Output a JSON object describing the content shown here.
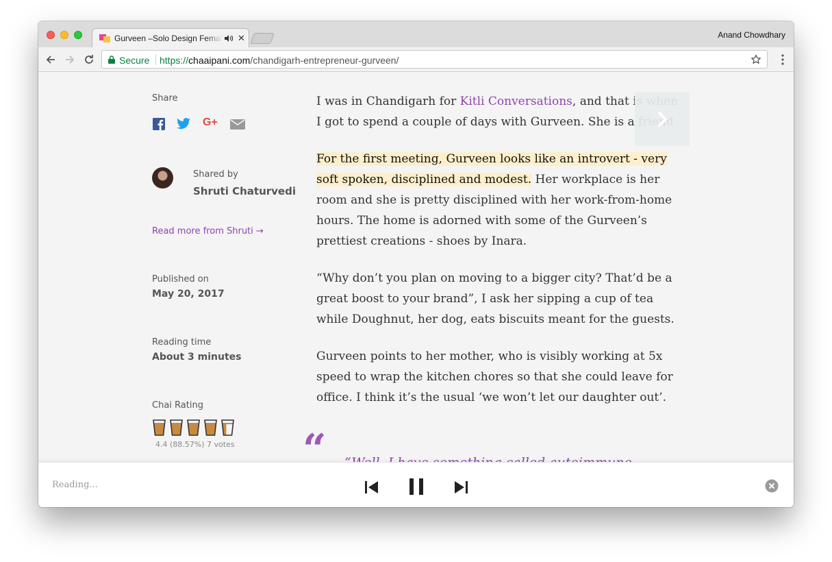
{
  "browser": {
    "tab_title": "Gurveen –Solo Design Female Entrepreneur",
    "tab_close": "✕",
    "profile_name": "Anand Chowdhary",
    "secure_label": "Secure",
    "url_scheme": "https://",
    "url_host": "chaaipani.com",
    "url_path": "/chandigarh-entrepreneur-gurveen/"
  },
  "sidebar": {
    "share_label": "Share",
    "share_icons": [
      "facebook-icon",
      "twitter-icon",
      "google-plus-icon",
      "email-icon"
    ],
    "google_plus_text": "G+",
    "shared_by_label": "Shared by",
    "author_name": "Shruti Chaturvedi",
    "read_more": "Read more from Shruti  →",
    "published_label": "Published on",
    "published_date": "May 20, 2017",
    "reading_time_label": "Reading time",
    "reading_time": "About 3 minutes",
    "chai_rating_label": "Chai Rating",
    "rating_value": 4.4,
    "rating_max": 5,
    "rating_text": "4.4 (88.57%) 7 votes"
  },
  "article": {
    "p1_before": "I was in Chandigarh for ",
    "p1_link": "Kitli Conversations",
    "p1_after": ", and that is when I got to spend a couple of days with Gurveen. She is a friend",
    "p2_highlight": "For the first meeting, Gurveen looks like an introvert - very soft spoken, disciplined and modest.",
    "p2_rest": " Her workplace is her room and she is pretty disciplined with her work-from-home hours. The home is adorned with some of the Gurveen’s prettiest creations - shoes by Inara.",
    "p3": "“Why don’t you plan on moving to a bigger city? That’d be a great boost to your brand”, I ask her sipping a cup of tea while Doughnut, her dog, eats biscuits meant for the guests.",
    "p4": "Gurveen points to her mother, who is visibly working at 5x speed to wrap the kitchen chores so that she could leave for office. I think it’s the usual ‘we won’t let our daughter out’.",
    "quote_mark": "“",
    "pullquote": "“Well, I have something called autoimmune disease. Basically, my immune system cannot differentiate"
  },
  "player": {
    "status": "Reading..."
  },
  "colors": {
    "accent": "#8e44ad",
    "highlight": "#fdefcc",
    "secure_green": "#0b8043",
    "facebook": "#3b5998",
    "twitter": "#1da1f2",
    "google_plus": "#dd4b39"
  }
}
